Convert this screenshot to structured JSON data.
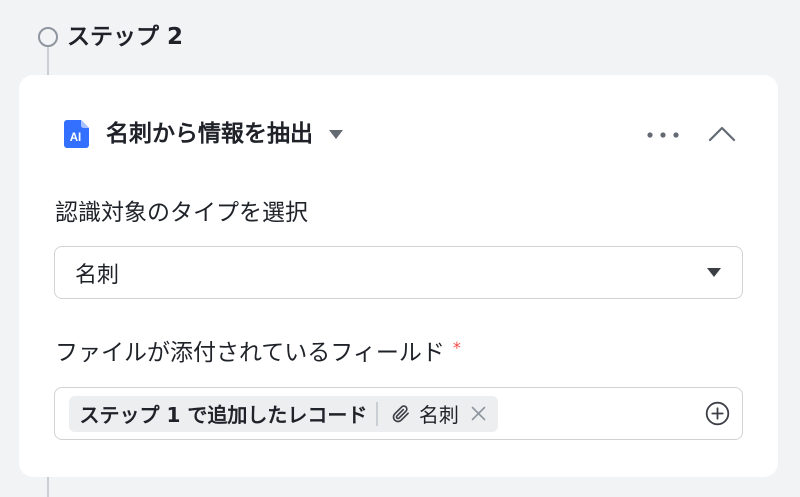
{
  "colors": {
    "background": "#f2f3f5",
    "card": "#ffffff",
    "text": "#1f2329",
    "muted": "#646a73",
    "border": "#d0d3d6",
    "accent": "#3370ff",
    "accent_light": "#a8c2ff",
    "required": "#f54a45",
    "chip": "#eceef0",
    "timeline": "#c9cdd4",
    "step_dot": "#8f959e",
    "icon_dark": "#3b3f45",
    "close": "#8f959e"
  },
  "step": {
    "label": "ステップ 2",
    "status_icon": "hollow-circle-icon"
  },
  "action_card": {
    "header": {
      "icon": "ai-document-icon",
      "icon_text": "AI",
      "title": "名刺から情報を抽出",
      "title_menu_icon": "caret-down-icon",
      "more_icon": "more-horizontal-icon",
      "collapse_icon": "chevron-up-icon"
    },
    "recognition_type": {
      "label": "認識対象のタイプを選択",
      "value": "名刺",
      "dropdown_icon": "caret-down-icon"
    },
    "attachment_field": {
      "label": "ファイルが添付されているフィールド",
      "required_mark": "*",
      "token": {
        "source": "ステップ 1 で追加したレコード",
        "field_icon": "paperclip-icon",
        "field": "名刺",
        "remove_icon": "close-icon"
      },
      "add_icon": "plus-circle-icon"
    }
  }
}
